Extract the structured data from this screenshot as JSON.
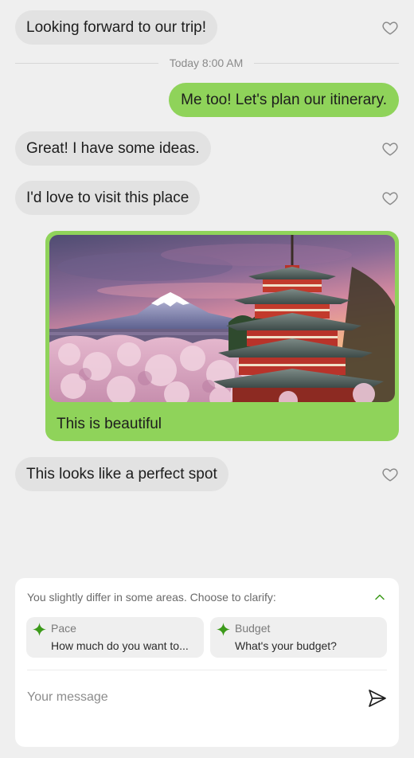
{
  "messages": {
    "m1": "Looking forward to our trip!",
    "divider": "Today 8:00 AM",
    "m2": "Me too! Let's plan our itinerary.",
    "m3": "Great! I have some ideas.",
    "m4": "I'd love to visit this place",
    "image_caption": "This is beautiful",
    "m5": "This looks like a perfect spot"
  },
  "clarify": {
    "title": "You slightly differ in some areas. Choose to clarify:",
    "chips": [
      {
        "title": "Pace",
        "subtitle": "How much do you want to..."
      },
      {
        "title": "Budget",
        "subtitle": "What's your budget?"
      }
    ]
  },
  "composer": {
    "placeholder": "Your message"
  },
  "colors": {
    "outgoing_bubble": "#8fd35a",
    "incoming_bubble": "#e2e2e2",
    "accent_green": "#3c9a1a",
    "background": "#efefef"
  },
  "icons": {
    "like": "heart-outline-icon",
    "collapse": "chevron-up-icon",
    "suggestion": "sparkle-icon",
    "send": "send-icon"
  }
}
